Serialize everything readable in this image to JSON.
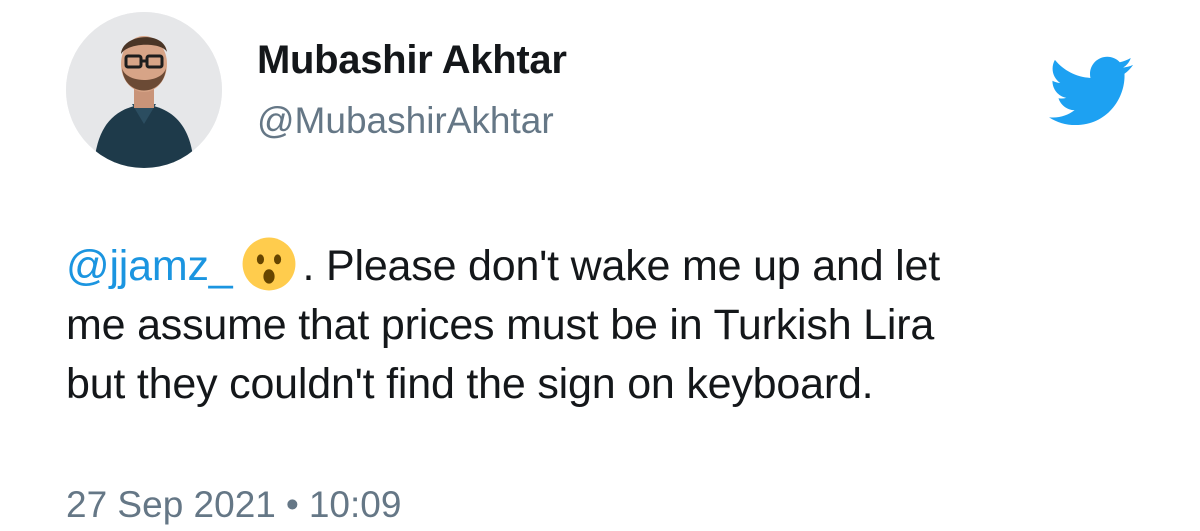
{
  "tweet": {
    "author": {
      "display_name": "Mubashir Akhtar",
      "handle": "@MubashirAkhtar",
      "avatar_icon": "person-avatar"
    },
    "logo_icon": "twitter-bird-icon",
    "text": {
      "mention": "@jjamz_",
      "emoji": "astonished-face-emoji",
      "line1_rest": ". Please don't wake me up and let",
      "line2": "me assume that prices must be in Turkish Lira",
      "line3": "but they couldn't find the sign on keyboard."
    },
    "date": "27 Sep 2021",
    "separator": "•",
    "time": "10:09"
  },
  "colors": {
    "brand_blue": "#1da1f2",
    "mention_blue": "#1b95e0",
    "text": "#14171a",
    "secondary_text": "#657786"
  }
}
